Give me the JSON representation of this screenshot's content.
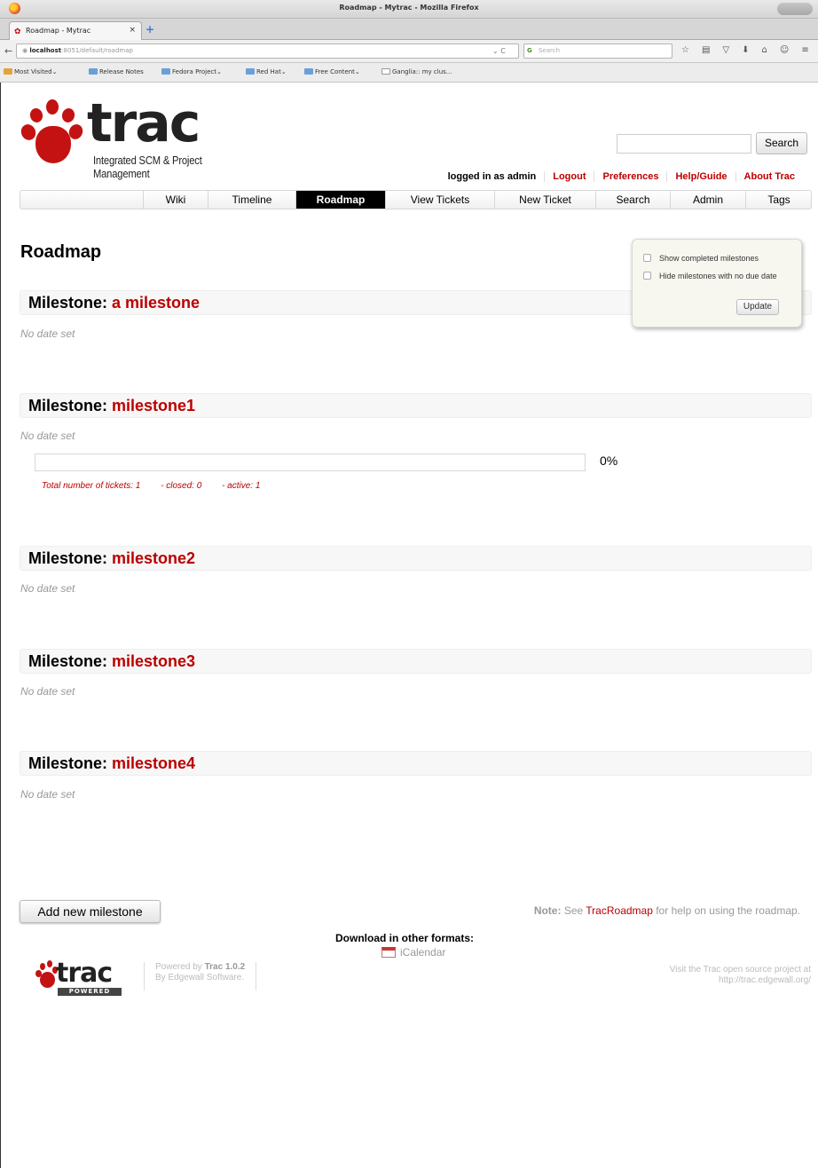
{
  "browser": {
    "window_title": "Roadmap - Mytrac - Mozilla Firefox",
    "window_button": "",
    "tab_label": "Roadmap - Mytrac",
    "tab_close": "×",
    "newtab": "+",
    "url_host": "localhost",
    "url_rest": ":8051/default/roadmap",
    "search_placeholder": "Search",
    "url_tools": "⌄  C",
    "toolbar_icons": [
      "☆",
      "▤",
      "▽",
      "⬇",
      "⌂",
      "☺",
      "≡"
    ]
  },
  "bookmarks": [
    {
      "label": "Most Visited⌄"
    },
    {
      "label": "Release Notes"
    },
    {
      "label": "Fedora Project⌄"
    },
    {
      "label": "Red Hat⌄"
    },
    {
      "label": "Free Content⌄"
    },
    {
      "label": "Ganglia:: my clus..."
    }
  ],
  "header": {
    "logo_word": "trac",
    "logo_tag": "Integrated SCM & Project Management",
    "search_button": "Search",
    "search_value": ""
  },
  "metanav": [
    "logged in as admin",
    "Logout",
    "Preferences",
    "Help/Guide",
    "About Trac"
  ],
  "mainnav": [
    {
      "label": "Wiki"
    },
    {
      "label": "Timeline"
    },
    {
      "label": "Roadmap",
      "active": true
    },
    {
      "label": "View Tickets"
    },
    {
      "label": "New Ticket"
    },
    {
      "label": "Search"
    },
    {
      "label": "Admin"
    },
    {
      "label": "Tags"
    }
  ],
  "page_title": "Roadmap",
  "filters": {
    "show_completed": "Show completed milestones",
    "hide_no_due": "Hide milestones with no due date",
    "update": "Update"
  },
  "milestone_prefix": "Milestone: ",
  "milestones": [
    {
      "name": "a milestone",
      "date": "No date set"
    },
    {
      "name": "milestone1",
      "date": "No date set"
    },
    {
      "name": "milestone2",
      "date": "No date set"
    },
    {
      "name": "milestone3",
      "date": "No date set"
    },
    {
      "name": "milestone4",
      "date": "No date set"
    }
  ],
  "progress": {
    "percent_label": "0%",
    "completed_fraction": 0,
    "total": "Total number of tickets: 1",
    "closed": "- closed: 0",
    "active": "- active: 1"
  },
  "add_milestone": "Add new milestone",
  "note": {
    "prefix": "Note:",
    "text1": " See ",
    "link": "TracRoadmap",
    "text2": " for help on using the roadmap."
  },
  "altlinks": {
    "title": "Download in other formats:",
    "ical": "iCalendar"
  },
  "footer": {
    "logo_word": "trac",
    "logo_badge": "POWERED",
    "powered_line1_prefix": "Powered by ",
    "powered_line1_bold": "Trac 1.0.2",
    "powered_line2": "By Edgewall Software.",
    "visit_line1": "Visit the Trac open source project at",
    "visit_line2": "http://trac.edgewall.org/"
  },
  "colors": {
    "link": "#bb0000",
    "active_tab": "#000000"
  }
}
